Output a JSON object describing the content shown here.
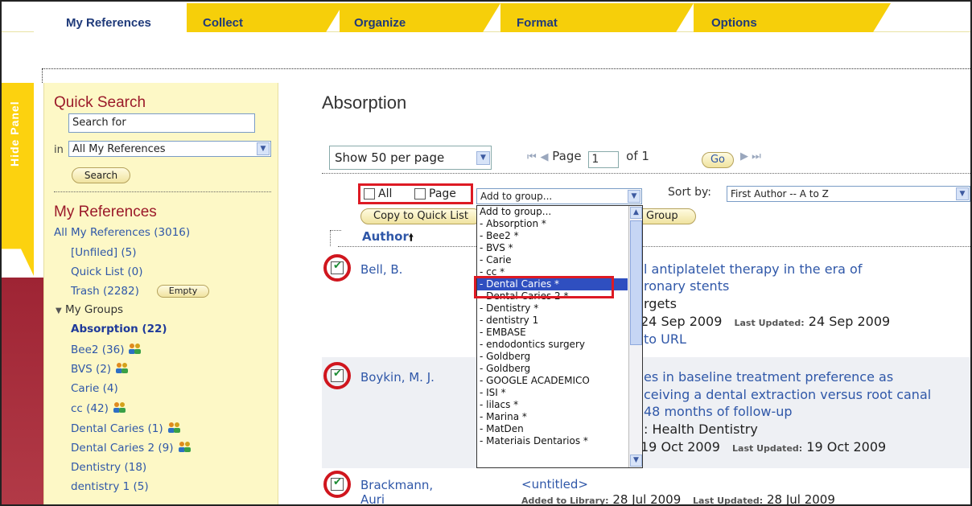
{
  "tabs": {
    "my_references": "My References",
    "collect": "Collect",
    "organize": "Organize",
    "format": "Format",
    "options": "Options"
  },
  "hide_panel": "Hide Panel",
  "sidebar": {
    "quick_search_heading": "Quick Search",
    "search_value": "Search for",
    "in_label": "in",
    "scope_value": "All My References",
    "search_button": "Search",
    "my_references_heading": "My References",
    "all_refs": "All My References (3016)",
    "unfiled": "[Unfiled] (5)",
    "quick_list": "Quick List (0)",
    "trash": "Trash (2282)",
    "empty_button": "Empty",
    "my_groups": "My Groups",
    "groups": [
      {
        "label": "Absorption (22)",
        "shared": false,
        "active": true
      },
      {
        "label": "Bee2 (36)",
        "shared": true
      },
      {
        "label": "BVS (2)",
        "shared": true
      },
      {
        "label": "Carie (4)",
        "shared": false
      },
      {
        "label": "cc (42)",
        "shared": true
      },
      {
        "label": "Dental Caries (1)",
        "shared": true
      },
      {
        "label": "Dental Caries 2 (9)",
        "shared": true
      },
      {
        "label": "Dentistry (18)",
        "shared": false
      },
      {
        "label": "dentistry 1 (5)",
        "shared": false
      }
    ]
  },
  "main": {
    "title": "Absorption",
    "per_page": "Show 50 per page",
    "page_label": "Page",
    "page_value": "1",
    "of_label": "of 1",
    "go_button": "Go",
    "all_label": "All",
    "page_cb_label": "Page",
    "group_select": "Add to group...",
    "sort_by_label": "Sort by:",
    "sort_value": "First Author -- A to Z",
    "copy_ql_button": "Copy to Quick List",
    "add_group_tail": "Group",
    "author_header": "Author"
  },
  "records": [
    {
      "author": "Bell, B.",
      "title_1": "l antiplatelet therapy in the era of",
      "title_2": "ronary stents",
      "journal": "rgets",
      "added_date": "24 Sep 2009",
      "updated_label": "Last Updated:",
      "updated_date": "24 Sep 2009",
      "link": "to URL"
    },
    {
      "author": "Boykin, M. J.",
      "title_1": "es in baseline treatment preference as",
      "title_2": "ceiving a dental extraction versus root canal",
      "title_3": "48 months of follow-up",
      "journal": ": Health Dentistry",
      "added_date": "19 Oct 2009",
      "updated_label": "Last Updated:",
      "updated_date": "19 Oct 2009"
    },
    {
      "author_1": "Brackmann,",
      "author_2": "Auri",
      "title": "<untitled>",
      "added_label": "Added to Library:",
      "added_date": "28 Jul 2009",
      "updated_label": "Last Updated:",
      "updated_date": "28 Jul 2009"
    }
  ],
  "dropdown": {
    "items": [
      "Add to group...",
      "- Absorption *",
      "- Bee2 *",
      "- BVS *",
      "- Carie",
      "- cc *",
      "- Dental Caries *",
      "- Dental Caries 2 *",
      "- Dentistry *",
      "- dentistry 1",
      "- EMBASE",
      "- endodontics surgery",
      "- Goldberg",
      "- Goldberg",
      "- GOOGLE ACADEMICO",
      "- ISI *",
      "- lilacs *",
      "- Marina *",
      "- MatDen",
      "- Materiais Dentarios *"
    ],
    "selected_index": 6
  },
  "colors": {
    "tab_yellow": "#f6cf0a",
    "sidebar_bg": "#fdf8c6",
    "heading_red": "#9b1a2a",
    "link_blue": "#2f57a8",
    "annotation_red": "#dd1a24",
    "selection_blue": "#2f4fc0"
  }
}
